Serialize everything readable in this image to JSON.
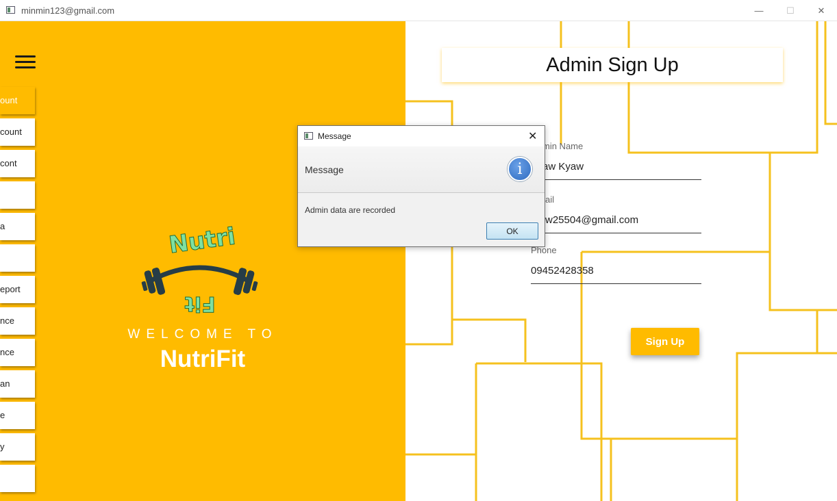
{
  "window": {
    "title": "minmin123@gmail.com",
    "min_icon": "—",
    "max_icon": "☐",
    "close_icon": "✕"
  },
  "sidebar": {
    "items": [
      {
        "label": "ount",
        "active": true
      },
      {
        "label": "count"
      },
      {
        "label": "cont"
      },
      {
        "label": ""
      },
      {
        "label": "a"
      },
      {
        "label": ""
      },
      {
        "label": "eport"
      },
      {
        "label": "nce"
      },
      {
        "label": "nce"
      },
      {
        "label": "an"
      },
      {
        "label": "e"
      },
      {
        "label": "y"
      },
      {
        "label": ""
      }
    ]
  },
  "welcome": {
    "line1": "WELCOME TO",
    "line2": "NutriFit"
  },
  "logo": {
    "top_text": "Nutri",
    "bottom_text": "Fit"
  },
  "form": {
    "header": "Admin Sign Up",
    "name_label": "min Name",
    "name_value": "aw Kyaw",
    "email_label": "ail",
    "email_value": "w25504@gmail.com",
    "phone_label": "Phone",
    "phone_value": "09452428358",
    "signup_label": "Sign Up"
  },
  "dialog": {
    "title": "Message",
    "header": "Message",
    "content": "Admin data are recorded",
    "ok_label": "OK",
    "info_glyph": "i",
    "close_glyph": "✕"
  },
  "colors": {
    "accent": "#FFBB00",
    "white": "#FFFFFF"
  }
}
